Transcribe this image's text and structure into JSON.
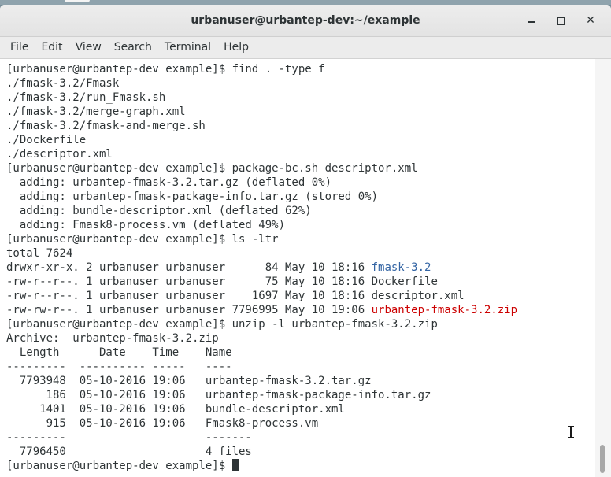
{
  "window": {
    "title": "urbanuser@urbantep-dev:~/example",
    "min_glyph": "",
    "close_glyph": "✕"
  },
  "menu": [
    "File",
    "Edit",
    "View",
    "Search",
    "Terminal",
    "Help"
  ],
  "terminal": {
    "lines": [
      "[urbanuser@urbantep-dev example]$ find . -type f",
      "./fmask-3.2/Fmask",
      "./fmask-3.2/run_Fmask.sh",
      "./fmask-3.2/merge-graph.xml",
      "./fmask-3.2/fmask-and-merge.sh",
      "./Dockerfile",
      "./descriptor.xml",
      "[urbanuser@urbantep-dev example]$ package-bc.sh descriptor.xml",
      "  adding: urbantep-fmask-3.2.tar.gz (deflated 0%)",
      "  adding: urbantep-fmask-package-info.tar.gz (stored 0%)",
      "  adding: bundle-descriptor.xml (deflated 62%)",
      "  adding: Fmask8-process.vm (deflated 49%)",
      "[urbanuser@urbantep-dev example]$ ls -ltr",
      "total 7624",
      "drwxr-xr-x. 2 urbanuser urbanuser      84 May 10 18:16 ",
      "-rw-r--r--. 1 urbanuser urbanuser      75 May 10 18:16 Dockerfile",
      "-rw-r--r--. 1 urbanuser urbanuser    1697 May 10 18:16 descriptor.xml",
      "-rw-rw-r--. 1 urbanuser urbanuser 7796995 May 10 19:06 ",
      "[urbanuser@urbantep-dev example]$ unzip -l urbantep-fmask-3.2.zip",
      "Archive:  urbantep-fmask-3.2.zip",
      "  Length      Date    Time    Name",
      "---------  ---------- -----   ----",
      "  7793948  05-10-2016 19:06   urbantep-fmask-3.2.tar.gz",
      "      186  05-10-2016 19:06   urbantep-fmask-package-info.tar.gz",
      "     1401  05-10-2016 19:06   bundle-descriptor.xml",
      "      915  05-10-2016 19:06   Fmask8-process.vm",
      "---------                     -------",
      "  7796450                     4 files",
      "[urbanuser@urbantep-dev example]$ "
    ],
    "dir_name": "fmask-3.2",
    "archive_name": "urbantep-fmask-3.2.zip",
    "colors": {
      "foreground": "#2e3436",
      "directory": "#3465a4",
      "archive": "#cc0000",
      "background": "#ffffff"
    }
  }
}
